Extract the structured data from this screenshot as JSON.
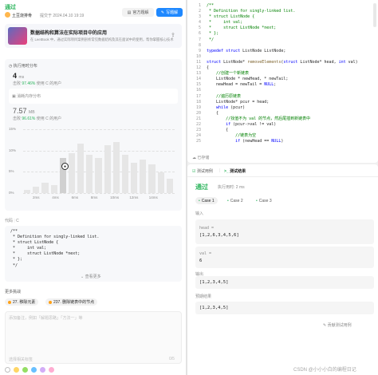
{
  "header": {
    "status": "通过",
    "user": "土豆烧排骨",
    "submitted": "提交于 2024.04.10 19:19",
    "solution_btn": "官方题解",
    "write_btn": "写题解"
  },
  "promo": {
    "title": "数据结构和算法在实际项目中的应用",
    "desc": "在 LeetBook 中，通过实际项目案例剖析常见数据结构及其在面试中的使用，帮你掌握核心技术"
  },
  "runtime": {
    "label": "执行用时分布",
    "value": "4",
    "unit": "ms",
    "beats_prefix": "击败",
    "beats": "97.46%",
    "beats_suffix": "使用 C 的用户"
  },
  "memory": {
    "label": "消耗内存分布",
    "value": "7.57",
    "unit": "MB",
    "beats_prefix": "击败",
    "beats": "96.61%",
    "beats_suffix": "使用 C 的用户"
  },
  "histogram": {
    "y_ticks": [
      "15%",
      "10%",
      "5%",
      "0%"
    ],
    "x_ticks": [
      "2ms",
      "4ms",
      "6ms",
      "8ms",
      "10ms",
      "12ms",
      "14ms"
    ],
    "bars": [
      0.05,
      0.1,
      0.16,
      0.12,
      0.55,
      0.62,
      0.78,
      0.6,
      0.55,
      0.75,
      0.8,
      0.6,
      0.48,
      0.52,
      0.45,
      0.32,
      0.22
    ]
  },
  "left_code": {
    "label": "代码",
    "lang": "C",
    "lines": [
      "/**",
      " * Definition for singly-linked list.",
      " * struct ListNode {",
      " *     int val;",
      " *     struct ListNode *next;",
      " * };",
      " */"
    ],
    "expand": "查看更多"
  },
  "related": {
    "label": "更多挑战",
    "items": [
      "27. 移除元素",
      "237. 删除链表中的节点"
    ]
  },
  "notes": {
    "placeholder": "添加备注，例如「解题思路」「方法一」等",
    "footer": "选择相关标签",
    "count": "0/5"
  },
  "editor": {
    "line_numbers": [
      "1",
      "2",
      "3",
      "4",
      "5",
      "6",
      "7",
      "8",
      "9",
      "10",
      "11",
      "12",
      "13",
      "14",
      "15",
      "16",
      "17",
      "18",
      "19",
      "20",
      "21",
      "22",
      "23",
      "24",
      "25"
    ],
    "lines": [
      "/**",
      " * Definition for singly-linked list.",
      " * struct ListNode {",
      " *     int val;",
      " *     struct ListNode *next;",
      " * };",
      " */",
      "",
      "typedef struct ListNode ListNode;",
      "",
      "struct ListNode* removeElements(struct ListNode* head, int val)",
      "{",
      "    //创建一个新链表",
      "    ListNode * newHead, * newTail;",
      "    newHead = newTail = NULL;",
      "",
      "    //遍历原链表",
      "    ListNode* pcur = head;",
      "    while (pcur)",
      "    {",
      "        //找值不为 val 的节点，然后尾插到新链表中",
      "        if (pcur->val != val)",
      "        {",
      "            //链表为空",
      "            if (newHead == NULL)"
    ],
    "saved": "已存储"
  },
  "result": {
    "tab_testcase": "测试用例",
    "tab_result": "测试结果",
    "status": "通过",
    "runtime": "执行用时: 2 ms",
    "cases": [
      "Case 1",
      "Case 2",
      "Case 3"
    ],
    "input_label": "输入",
    "head_label": "head =",
    "head_value": "[1,2,6,3,4,5,6]",
    "val_label": "val =",
    "val_value": "6",
    "output_label": "输出",
    "output_value": "[1,2,3,4,5]",
    "expected_label": "预期结果",
    "expected_value": "[1,2,3,4,5]",
    "contribute": "贡献测试用例"
  },
  "watermark": "CSDN @小小小白的编程日记"
}
